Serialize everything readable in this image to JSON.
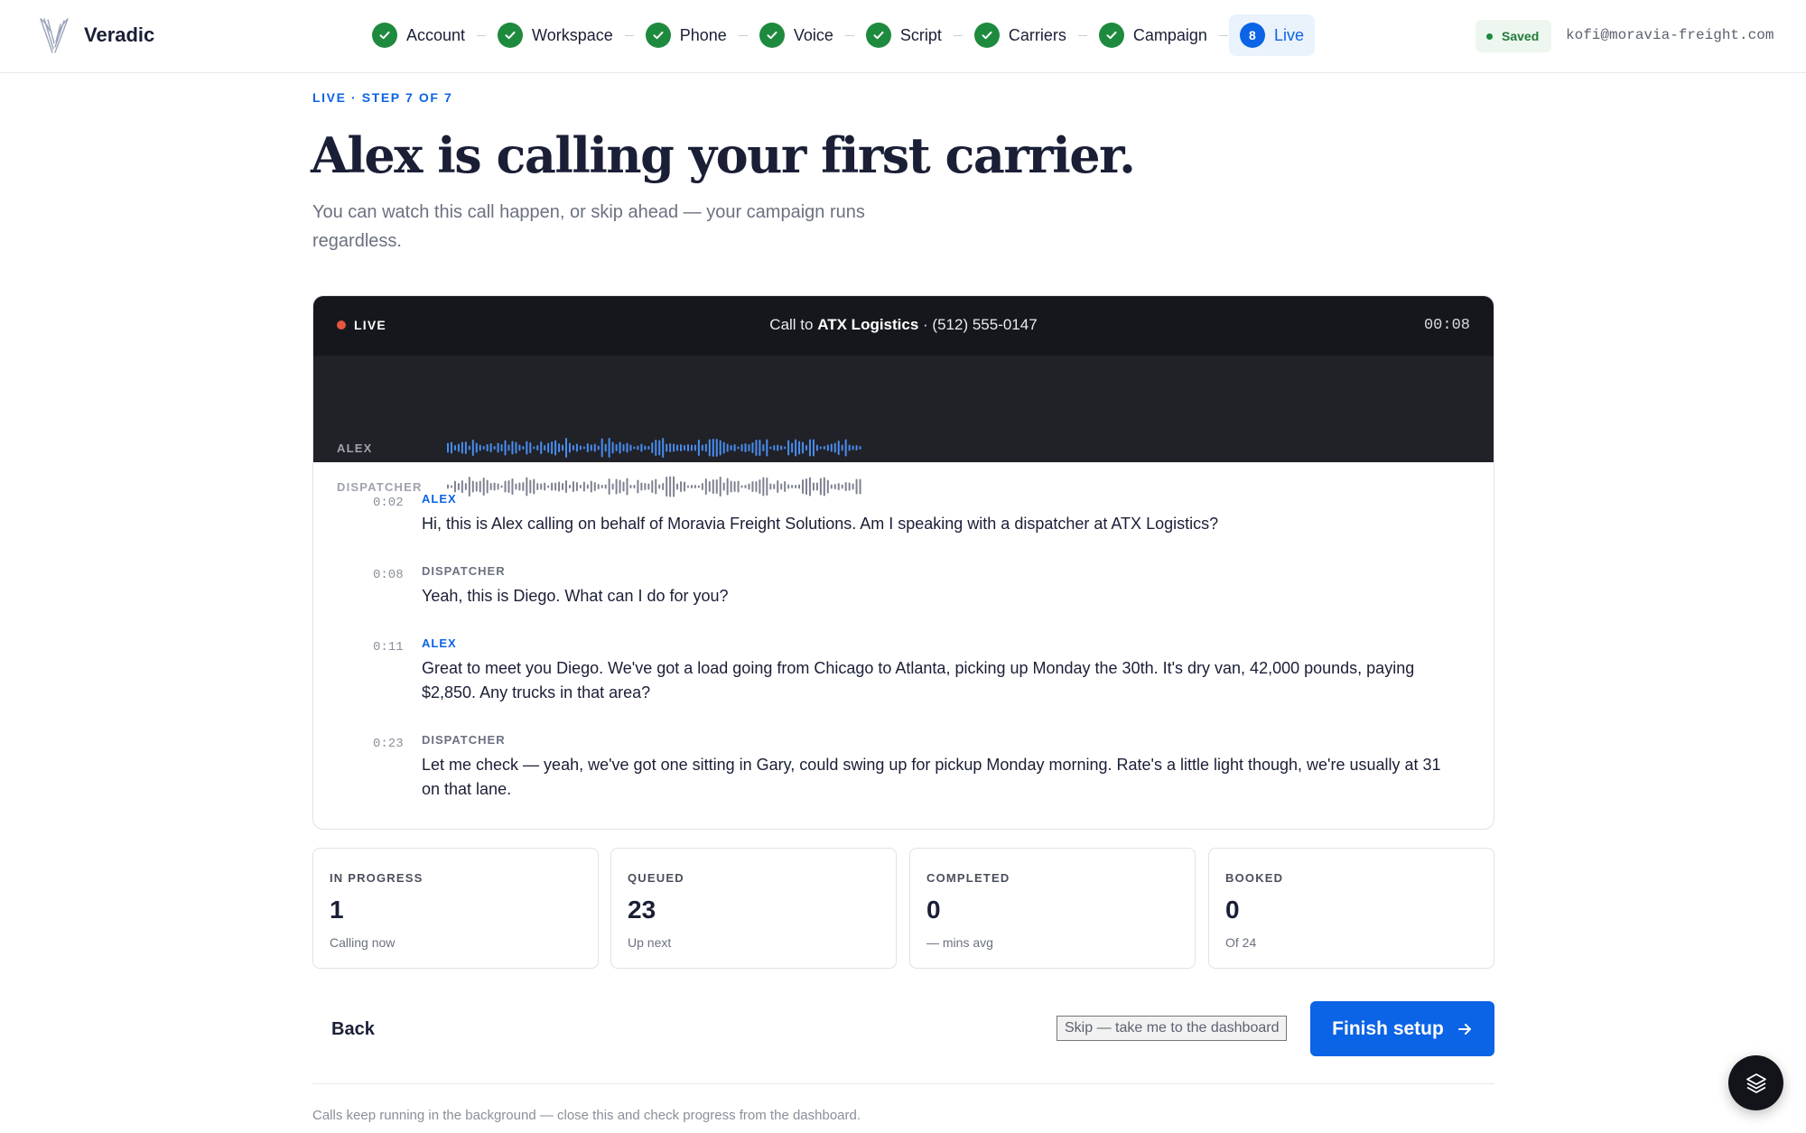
{
  "app": {
    "brand": "Veradic"
  },
  "steps": [
    {
      "label": "Account",
      "state": "done"
    },
    {
      "label": "Workspace",
      "state": "done"
    },
    {
      "label": "Phone",
      "state": "done"
    },
    {
      "label": "Voice",
      "state": "done"
    },
    {
      "label": "Script",
      "state": "done"
    },
    {
      "label": "Carriers",
      "state": "done"
    },
    {
      "label": "Campaign",
      "state": "done"
    },
    {
      "label": "Live",
      "state": "current",
      "number": "8"
    }
  ],
  "header": {
    "saved_label": "Saved",
    "email": "kofi@moravia-freight.com"
  },
  "page": {
    "eyebrow": "LIVE · STEP 7 OF 7",
    "title": "Alex is calling your first carrier.",
    "subtitle": "You can watch this call happen, or skip ahead — your campaign runs regardless."
  },
  "call": {
    "live_label": "LIVE",
    "title_prefix": "Call to ",
    "carrier": "ATX Logistics",
    "title_suffix": " · (512) 555-0147",
    "timer": "00:08",
    "tracks": [
      {
        "label": "ALEX",
        "color": "#4a8df0"
      },
      {
        "label": "DISPATCHER",
        "color": "#7d8190"
      }
    ],
    "transcript": [
      {
        "time": "0:02",
        "speaker": "ALEX",
        "text": "Hi, this is Alex calling on behalf of Moravia Freight Solutions. Am I speaking with a dispatcher at ATX Logistics?"
      },
      {
        "time": "0:08",
        "speaker": "DISPATCHER",
        "text": "Yeah, this is Diego. What can I do for you?"
      },
      {
        "time": "0:11",
        "speaker": "ALEX",
        "text": "Great to meet you Diego. We've got a load going from Chicago to Atlanta, picking up Monday the 30th. It's dry van, 42,000 pounds, paying $2,850. Any trucks in that area?"
      },
      {
        "time": "0:23",
        "speaker": "DISPATCHER",
        "text": "Let me check — yeah, we've got one sitting in Gary, could swing up for pickup Monday morning. Rate's a little light though, we're usually at 31 on that lane."
      }
    ]
  },
  "stats": [
    {
      "label": "IN PROGRESS",
      "value": "1",
      "sub": "Calling now"
    },
    {
      "label": "QUEUED",
      "value": "23",
      "sub": "Up next"
    },
    {
      "label": "COMPLETED",
      "value": "0",
      "sub": "— mins avg"
    },
    {
      "label": "BOOKED",
      "value": "0",
      "sub": "Of 24"
    }
  ],
  "actions": {
    "back": "Back",
    "skip": "Skip — take me to the dashboard",
    "finish": "Finish setup"
  },
  "footer": {
    "note": "Calls keep running in the background — close this and check progress from the dashboard."
  },
  "colors": {
    "accent": "#0b63e5",
    "done": "#1e8a3e",
    "live_dot": "#e8553f",
    "panel_dark": "#15171c"
  },
  "icons": {
    "step_done": "check-icon",
    "finish": "arrow-right-icon",
    "fab": "layers-icon",
    "logo": "veradic-logo-icon"
  }
}
